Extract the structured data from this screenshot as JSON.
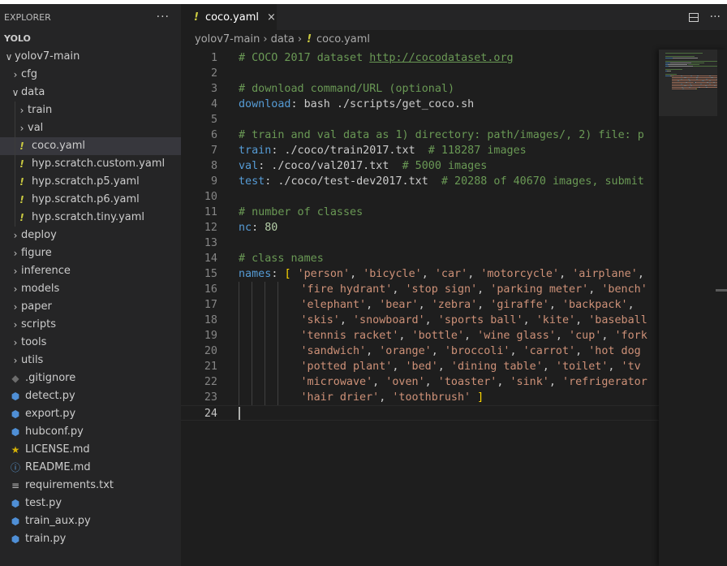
{
  "sidebar": {
    "header": "EXPLORER",
    "more": "···",
    "root": "YOLO",
    "tree": [
      {
        "label": "yolov7-main",
        "kind": "folder",
        "open": true,
        "depth": 0
      },
      {
        "label": "cfg",
        "kind": "folder",
        "open": false,
        "depth": 1
      },
      {
        "label": "data",
        "kind": "folder",
        "open": true,
        "depth": 1
      },
      {
        "label": "train",
        "kind": "folder",
        "open": false,
        "depth": 2
      },
      {
        "label": "val",
        "kind": "folder",
        "open": false,
        "depth": 2
      },
      {
        "label": "coco.yaml",
        "kind": "yaml",
        "depth": 2,
        "selected": true
      },
      {
        "label": "hyp.scratch.custom.yaml",
        "kind": "yaml",
        "depth": 2
      },
      {
        "label": "hyp.scratch.p5.yaml",
        "kind": "yaml",
        "depth": 2
      },
      {
        "label": "hyp.scratch.p6.yaml",
        "kind": "yaml",
        "depth": 2
      },
      {
        "label": "hyp.scratch.tiny.yaml",
        "kind": "yaml",
        "depth": 2
      },
      {
        "label": "deploy",
        "kind": "folder",
        "open": false,
        "depth": 1
      },
      {
        "label": "figure",
        "kind": "folder",
        "open": false,
        "depth": 1
      },
      {
        "label": "inference",
        "kind": "folder",
        "open": false,
        "depth": 1
      },
      {
        "label": "models",
        "kind": "folder",
        "open": false,
        "depth": 1
      },
      {
        "label": "paper",
        "kind": "folder",
        "open": false,
        "depth": 1
      },
      {
        "label": "scripts",
        "kind": "folder",
        "open": false,
        "depth": 1
      },
      {
        "label": "tools",
        "kind": "folder",
        "open": false,
        "depth": 1
      },
      {
        "label": "utils",
        "kind": "folder",
        "open": false,
        "depth": 1
      },
      {
        "label": ".gitignore",
        "kind": "git",
        "depth": 1
      },
      {
        "label": "detect.py",
        "kind": "py",
        "depth": 1
      },
      {
        "label": "export.py",
        "kind": "py",
        "depth": 1
      },
      {
        "label": "hubconf.py",
        "kind": "py",
        "depth": 1
      },
      {
        "label": "LICENSE.md",
        "kind": "license",
        "depth": 1
      },
      {
        "label": "README.md",
        "kind": "info",
        "depth": 1
      },
      {
        "label": "requirements.txt",
        "kind": "txt",
        "depth": 1
      },
      {
        "label": "test.py",
        "kind": "py",
        "depth": 1
      },
      {
        "label": "train_aux.py",
        "kind": "py",
        "depth": 1
      },
      {
        "label": "train.py",
        "kind": "py",
        "depth": 1
      }
    ]
  },
  "icons": {
    "folder_open": "chevron-down-icon",
    "folder_closed": "chevron-right-icon",
    "yaml": "yaml-file-icon",
    "py": "python-file-icon",
    "git": "git-file-icon",
    "license": "license-file-icon",
    "info": "info-file-icon",
    "txt": "text-file-icon"
  },
  "tab": {
    "label": "coco.yaml",
    "close": "×"
  },
  "tab_actions": {
    "more": "···"
  },
  "breadcrumb": [
    "yolov7-main",
    "data",
    "coco.yaml"
  ],
  "editor": {
    "active_line": 24,
    "lines": [
      {
        "n": "1",
        "parts": [
          [
            "com",
            "# COCO 2017 dataset "
          ],
          [
            "link",
            "http://cocodataset.org"
          ]
        ]
      },
      {
        "n": "2",
        "parts": []
      },
      {
        "n": "3",
        "parts": [
          [
            "com",
            "# download command/URL (optional)"
          ]
        ]
      },
      {
        "n": "4",
        "parts": [
          [
            "key",
            "download"
          ],
          [
            "txt",
            ": bash ./scripts/get_coco.sh"
          ]
        ]
      },
      {
        "n": "5",
        "parts": []
      },
      {
        "n": "6",
        "parts": [
          [
            "com",
            "# train and val data as 1) directory: path/images/, 2) file: p"
          ]
        ]
      },
      {
        "n": "7",
        "parts": [
          [
            "key",
            "train"
          ],
          [
            "txt",
            ": ./coco/train2017.txt  "
          ],
          [
            "com",
            "# 118287 images"
          ]
        ]
      },
      {
        "n": "8",
        "parts": [
          [
            "key",
            "val"
          ],
          [
            "txt",
            ": ./coco/val2017.txt  "
          ],
          [
            "com",
            "# 5000 images"
          ]
        ]
      },
      {
        "n": "9",
        "parts": [
          [
            "key",
            "test"
          ],
          [
            "txt",
            ": ./coco/test-dev2017.txt  "
          ],
          [
            "com",
            "# 20288 of 40670 images, submit"
          ]
        ]
      },
      {
        "n": "10",
        "parts": []
      },
      {
        "n": "11",
        "parts": [
          [
            "com",
            "# number of classes"
          ]
        ]
      },
      {
        "n": "12",
        "parts": [
          [
            "key",
            "nc"
          ],
          [
            "txt",
            ": "
          ],
          [
            "num",
            "80"
          ]
        ]
      },
      {
        "n": "13",
        "parts": []
      },
      {
        "n": "14",
        "parts": [
          [
            "com",
            "# class names"
          ]
        ]
      },
      {
        "n": "15",
        "parts": [
          [
            "key",
            "names"
          ],
          [
            "txt",
            ": "
          ],
          [
            "br",
            "["
          ],
          [
            "txt",
            " "
          ],
          [
            "str",
            "'person'"
          ],
          [
            "txt",
            ", "
          ],
          [
            "str",
            "'bicycle'"
          ],
          [
            "txt",
            ", "
          ],
          [
            "str",
            "'car'"
          ],
          [
            "txt",
            ", "
          ],
          [
            "str",
            "'motorcycle'"
          ],
          [
            "txt",
            ", "
          ],
          [
            "str",
            "'airplane'"
          ],
          [
            "txt",
            ","
          ]
        ]
      },
      {
        "n": "16",
        "indent": true,
        "parts": [
          [
            "str",
            "'fire hydrant'"
          ],
          [
            "txt",
            ", "
          ],
          [
            "str",
            "'stop sign'"
          ],
          [
            "txt",
            ", "
          ],
          [
            "str",
            "'parking meter'"
          ],
          [
            "txt",
            ", "
          ],
          [
            "str",
            "'bench'"
          ]
        ]
      },
      {
        "n": "17",
        "indent": true,
        "parts": [
          [
            "str",
            "'elephant'"
          ],
          [
            "txt",
            ", "
          ],
          [
            "str",
            "'bear'"
          ],
          [
            "txt",
            ", "
          ],
          [
            "str",
            "'zebra'"
          ],
          [
            "txt",
            ", "
          ],
          [
            "str",
            "'giraffe'"
          ],
          [
            "txt",
            ", "
          ],
          [
            "str",
            "'backpack'"
          ],
          [
            "txt",
            ", "
          ]
        ]
      },
      {
        "n": "18",
        "indent": true,
        "parts": [
          [
            "str",
            "'skis'"
          ],
          [
            "txt",
            ", "
          ],
          [
            "str",
            "'snowboard'"
          ],
          [
            "txt",
            ", "
          ],
          [
            "str",
            "'sports ball'"
          ],
          [
            "txt",
            ", "
          ],
          [
            "str",
            "'kite'"
          ],
          [
            "txt",
            ", "
          ],
          [
            "str",
            "'baseball"
          ]
        ]
      },
      {
        "n": "19",
        "indent": true,
        "parts": [
          [
            "str",
            "'tennis racket'"
          ],
          [
            "txt",
            ", "
          ],
          [
            "str",
            "'bottle'"
          ],
          [
            "txt",
            ", "
          ],
          [
            "str",
            "'wine glass'"
          ],
          [
            "txt",
            ", "
          ],
          [
            "str",
            "'cup'"
          ],
          [
            "txt",
            ", "
          ],
          [
            "str",
            "'fork"
          ]
        ]
      },
      {
        "n": "20",
        "indent": true,
        "parts": [
          [
            "str",
            "'sandwich'"
          ],
          [
            "txt",
            ", "
          ],
          [
            "str",
            "'orange'"
          ],
          [
            "txt",
            ", "
          ],
          [
            "str",
            "'broccoli'"
          ],
          [
            "txt",
            ", "
          ],
          [
            "str",
            "'carrot'"
          ],
          [
            "txt",
            ", "
          ],
          [
            "str",
            "'hot dog"
          ]
        ]
      },
      {
        "n": "21",
        "indent": true,
        "parts": [
          [
            "str",
            "'potted plant'"
          ],
          [
            "txt",
            ", "
          ],
          [
            "str",
            "'bed'"
          ],
          [
            "txt",
            ", "
          ],
          [
            "str",
            "'dining table'"
          ],
          [
            "txt",
            ", "
          ],
          [
            "str",
            "'toilet'"
          ],
          [
            "txt",
            ", "
          ],
          [
            "str",
            "'tv"
          ]
        ]
      },
      {
        "n": "22",
        "indent": true,
        "parts": [
          [
            "str",
            "'microwave'"
          ],
          [
            "txt",
            ", "
          ],
          [
            "str",
            "'oven'"
          ],
          [
            "txt",
            ", "
          ],
          [
            "str",
            "'toaster'"
          ],
          [
            "txt",
            ", "
          ],
          [
            "str",
            "'sink'"
          ],
          [
            "txt",
            ", "
          ],
          [
            "str",
            "'refrigerator"
          ]
        ]
      },
      {
        "n": "23",
        "indent": true,
        "parts": [
          [
            "str",
            "'hair drier'"
          ],
          [
            "txt",
            ", "
          ],
          [
            "str",
            "'toothbrush'"
          ],
          [
            "txt",
            " "
          ],
          [
            "br",
            "]"
          ]
        ]
      },
      {
        "n": "24",
        "parts": []
      }
    ]
  },
  "colors": {
    "background": "#1e1e1e",
    "sidebar": "#252526",
    "selection": "#37373d",
    "comment": "#6a9955",
    "key": "#569cd6",
    "string": "#ce9178",
    "number": "#b5cea8",
    "bracket": "#ffd700",
    "yaml_icon": "#cbcb41",
    "python_icon": "#4f8fd6"
  }
}
